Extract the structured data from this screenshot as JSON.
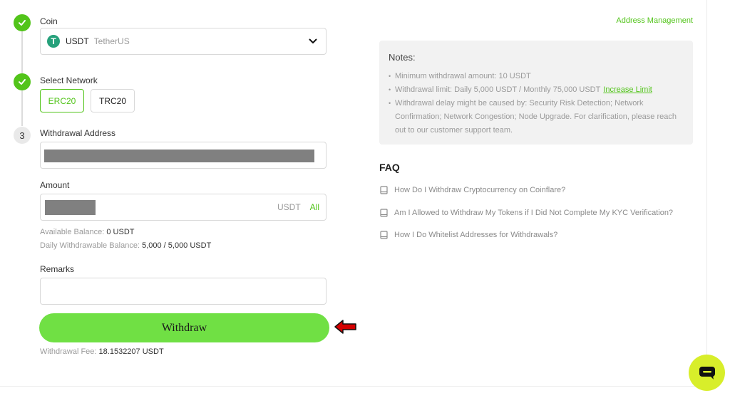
{
  "steps": {
    "step1_state": "done",
    "step2_state": "done",
    "step3_number": "3"
  },
  "coin": {
    "label": "Coin",
    "icon": "tether-icon",
    "icon_glyph": "T",
    "symbol": "USDT",
    "name": "TetherUS"
  },
  "network": {
    "label": "Select Network",
    "options": [
      "ERC20",
      "TRC20"
    ],
    "selected": "ERC20"
  },
  "address": {
    "label": "Withdrawal Address",
    "value_redacted": true
  },
  "amount": {
    "label": "Amount",
    "value_redacted": true,
    "unit": "USDT",
    "all_label": "All"
  },
  "balances": {
    "available_label": "Available Balance:",
    "available_value": "0 USDT",
    "daily_label": "Daily Withdrawable Balance:",
    "daily_value": "5,000 / 5,000 USDT"
  },
  "remarks": {
    "label": "Remarks",
    "value": ""
  },
  "withdraw_button": {
    "label": "Withdraw"
  },
  "fee": {
    "label": "Withdrawal Fee:",
    "value": "18.1532207 USDT"
  },
  "address_management_link": "Address Management",
  "notes": {
    "title": "Notes:",
    "item1": "Minimum withdrawal amount: 10 USDT",
    "item2": "Withdrawal limit: Daily 5,000 USDT / Monthly 75,000 USDT",
    "item2_link": "Increase Limit",
    "item3": "Withdrawal delay might be caused by: Security Risk Detection; Network Confirmation; Network Congestion; Node Upgrade. For clarification, please reach out to our customer support team."
  },
  "faq": {
    "title": "FAQ",
    "items": [
      "How Do I Withdraw Cryptocurrency on Coinflare?",
      "Am I Allowed to Withdraw My Tokens if I Did Not Complete My KYC Verification?",
      "How I Do Whitelist Addresses for Withdrawals?"
    ]
  },
  "colors": {
    "accent_green": "#52c41a",
    "button_green": "#70e044",
    "chat_yellow": "#d8ee2a",
    "arrow_red": "#d40000"
  }
}
